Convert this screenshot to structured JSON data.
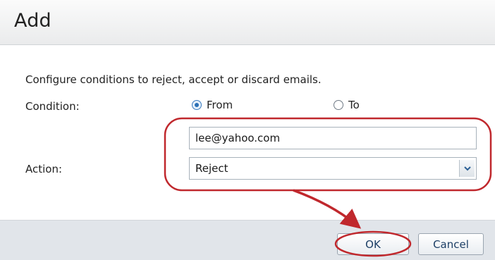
{
  "dialog": {
    "title": "Add",
    "description": "Configure conditions to reject, accept or discard emails."
  },
  "form": {
    "condition_label": "Condition:",
    "condition_options": [
      {
        "label": "From",
        "checked": true
      },
      {
        "label": "To",
        "checked": false
      }
    ],
    "email_value": "lee@yahoo.com",
    "action_label": "Action:",
    "action_value": "Reject"
  },
  "footer": {
    "ok_label": "OK",
    "cancel_label": "Cancel"
  },
  "colors": {
    "annotation": "#c0282d",
    "footer_bg": "#e1e5ea",
    "title_bg": "#eaebec"
  },
  "icons": {
    "select_arrow": "chevron-down-icon",
    "annotation_arrow": "red-arrow-icon"
  }
}
